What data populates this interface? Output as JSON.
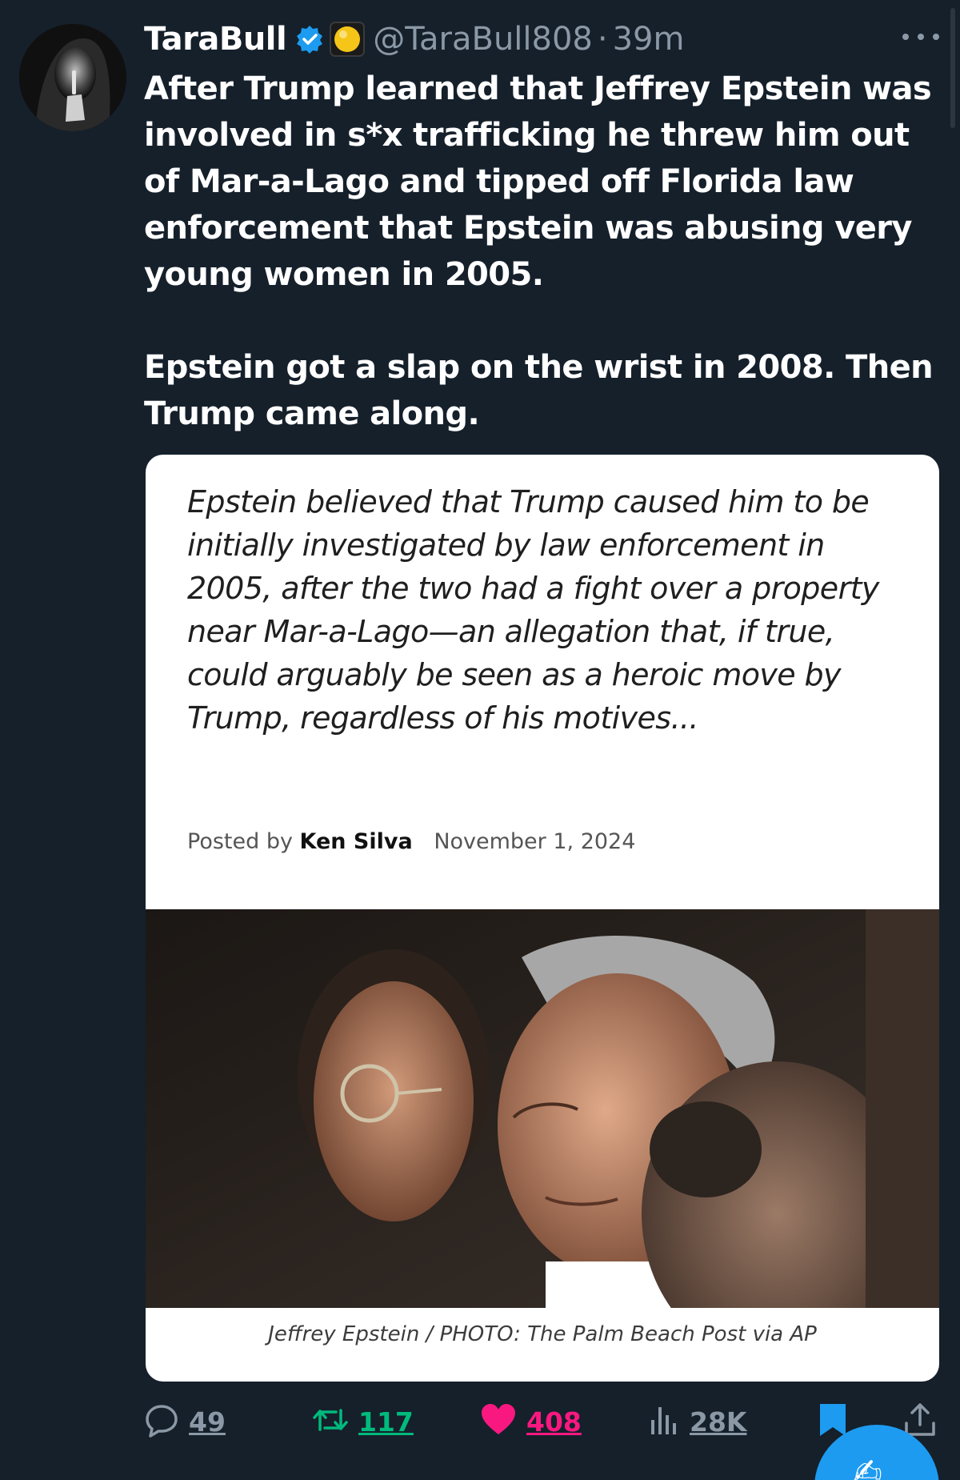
{
  "tweet": {
    "display_name": "TaraBull",
    "handle": "@TaraBull808",
    "separator": "·",
    "time": "39m",
    "icons": {
      "verified": "verified-badge-icon",
      "emoji": "yellow-circle-emoji-icon",
      "more": "more-options-icon"
    },
    "text": "After Trump learned that Jeffrey Epstein was involved in s*x trafficking he threw him out of Mar-a-Lago and tipped off Florida law enforcement that Epstein was abusing very young women in 2005.\n\nEpstein got a slap on the wrist in 2008. Then Trump came along."
  },
  "card": {
    "quote": "Epstein believed that Trump caused him to be initially investigated by law enforcement in 2005, after the two had a fight over a property near Mar-a-Lago—an allegation that, if true, could arguably be seen as a heroic move by Trump, regardless of his motives...",
    "posted_by_label": "Posted by",
    "author": "Ken Silva",
    "date": "November 1, 2024",
    "photo_caption": "Jeffrey Epstein / PHOTO: The Palm Beach Post via AP"
  },
  "actions": {
    "replies": "49",
    "retweets": "117",
    "likes": "408",
    "views": "28K",
    "icons": [
      "reply-icon",
      "retweet-icon",
      "like-icon",
      "views-icon",
      "bookmark-icon",
      "share-icon",
      "compose-icon"
    ]
  },
  "colors": {
    "background": "#15202b",
    "muted": "#8b98a5",
    "accent": "#1d9bf0",
    "retweet": "#00ba7c",
    "like": "#f91880"
  }
}
